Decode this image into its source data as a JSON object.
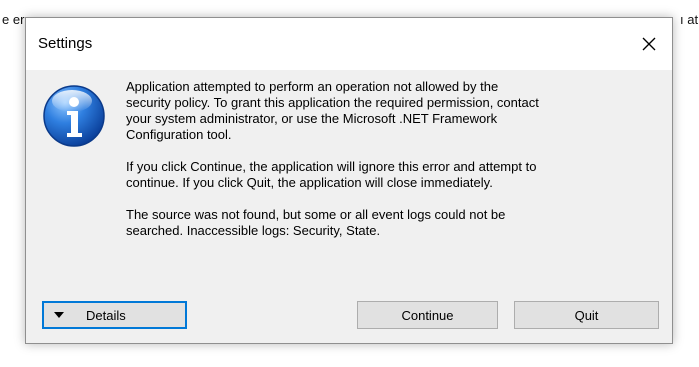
{
  "background": {
    "left_fragment": "e er",
    "right_fragment": "ı at"
  },
  "dialog": {
    "title": "Settings",
    "close_glyph": "✕",
    "icon": "info-icon",
    "messages": [
      "Application attempted to perform an operation not allowed by the\nsecurity policy. To grant this application the required permission, contact\nyour system administrator, or use the Microsoft .NET Framework\nConfiguration tool.",
      "If you click Continue, the application will ignore this error and attempt to\ncontinue. If you click Quit, the application will close immediately.",
      "The source was not found, but some or all event logs could not be\nsearched.  Inaccessible logs: Security, State."
    ],
    "buttons": {
      "details": "Details",
      "continue": "Continue",
      "quit": "Quit"
    }
  },
  "colors": {
    "focus_border": "#0078d7",
    "dialog_bg": "#f0f0f0",
    "button_bg": "#e1e1e1"
  }
}
